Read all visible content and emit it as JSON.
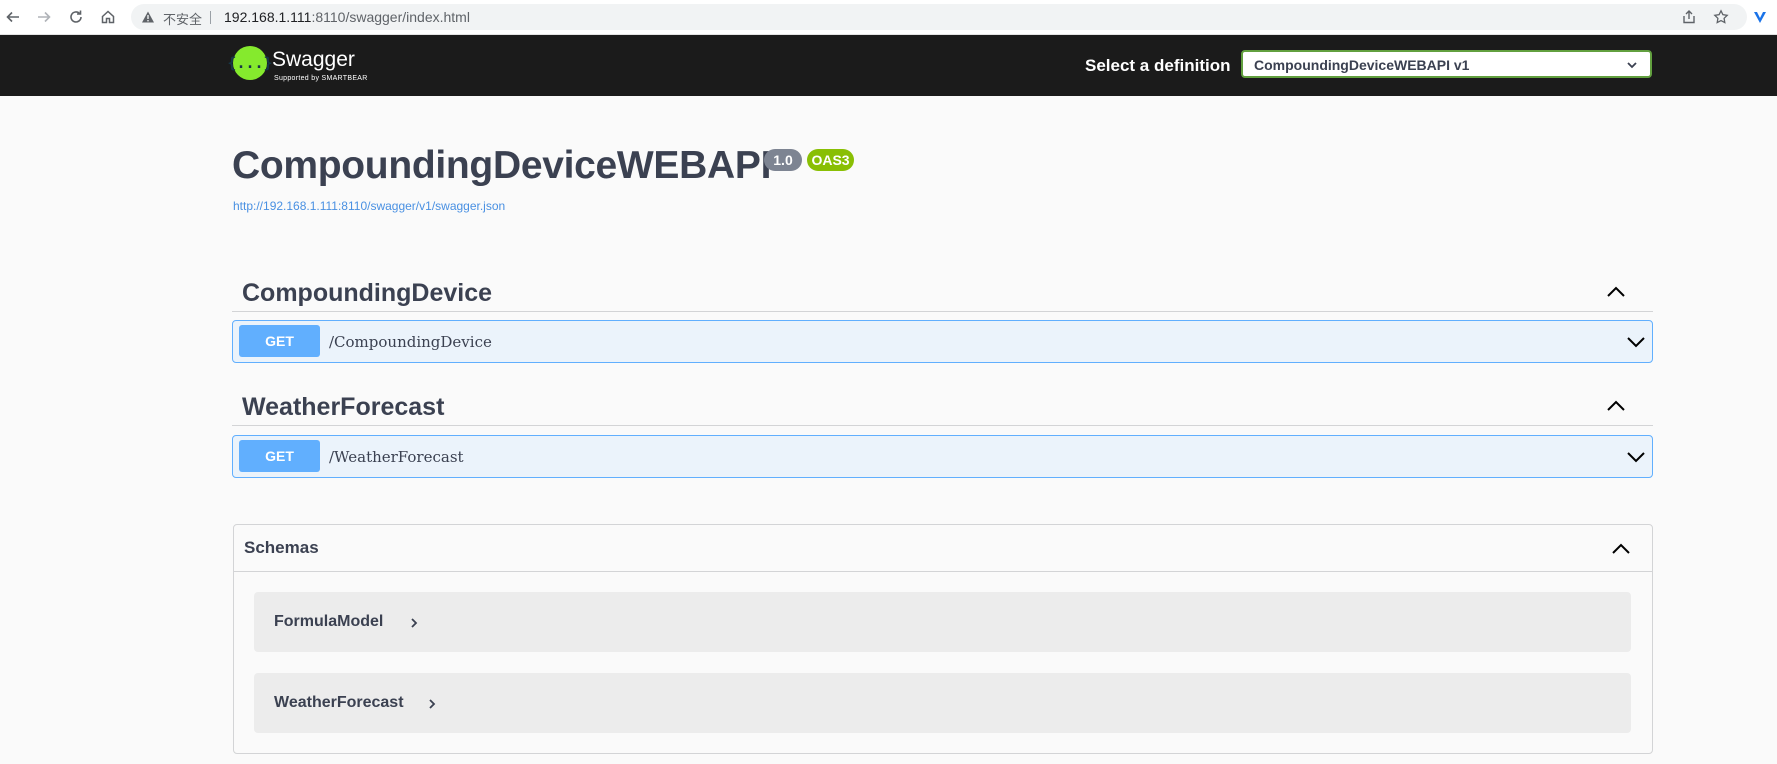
{
  "browser": {
    "insecure_label": "不安全",
    "url_host": "192.168.1.111",
    "url_rest": ":8110/swagger/index.html"
  },
  "topbar": {
    "logo_glyph": "{...}",
    "logo_title": "Swagger",
    "logo_subtitle": "Supported by SMARTBEAR",
    "select_label": "Select a definition",
    "selected_definition": "CompoundingDeviceWEBAPI v1"
  },
  "info": {
    "title": "CompoundingDeviceWEBAPI",
    "version": "1.0",
    "oas_badge": "OAS3",
    "spec_url": "http://192.168.1.111:8110/swagger/v1/swagger.json"
  },
  "tags": [
    {
      "name": "CompoundingDevice",
      "operations": [
        {
          "method": "GET",
          "path": "/CompoundingDevice"
        }
      ]
    },
    {
      "name": "WeatherForecast",
      "operations": [
        {
          "method": "GET",
          "path": "/WeatherForecast"
        }
      ]
    }
  ],
  "schemas": {
    "title": "Schemas",
    "models": [
      "FormulaModel",
      "WeatherForecast"
    ]
  },
  "colors": {
    "get_method": "#61affe",
    "get_bg": "#ebf3fb",
    "topbar_bg": "#1b1b1b",
    "swagger_green": "#85ea2d",
    "oas_badge": "#89bf04",
    "version_badge": "#7d8492",
    "link": "#4990e2"
  }
}
